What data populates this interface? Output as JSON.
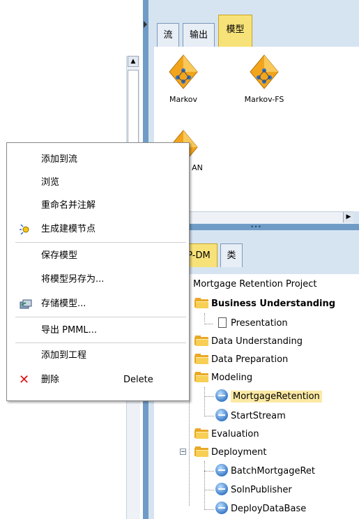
{
  "palette_tabs": [
    "流",
    "输出",
    "模型"
  ],
  "models": [
    {
      "label": "Markov",
      "icon": "model-nugget-icon"
    },
    {
      "label": "Markov-FS",
      "icon": "model-nugget-icon"
    },
    {
      "label": "AN",
      "icon": "model-nugget-icon"
    }
  ],
  "manager_tabs": [
    "P-DM",
    "类"
  ],
  "context_menu": {
    "items": [
      {
        "label": "添加到流"
      },
      {
        "label": "浏览"
      },
      {
        "label": "重命名并注解"
      },
      {
        "label": "生成建模节点",
        "icon": "sparkle-icon"
      },
      {
        "label": "保存模型"
      },
      {
        "label": "将模型另存为..."
      },
      {
        "label": "存储模型...",
        "icon": "store-icon"
      },
      {
        "label": "导出 PMML..."
      },
      {
        "label": "添加到工程"
      },
      {
        "label": "删除",
        "icon": "delete-x-icon",
        "shortcut": "Delete"
      }
    ]
  },
  "project_tree": {
    "root": "Mortgage Retention Project",
    "nodes": [
      {
        "label": "Business Understanding",
        "type": "folder"
      },
      {
        "label": "Presentation",
        "type": "document"
      },
      {
        "label": "Data Understanding",
        "type": "folder"
      },
      {
        "label": "Data Preparation",
        "type": "folder"
      },
      {
        "label": "Modeling",
        "type": "folder"
      },
      {
        "label": "MortgageRetention",
        "type": "stream"
      },
      {
        "label": "StartStream",
        "type": "stream"
      },
      {
        "label": "Evaluation",
        "type": "folder"
      },
      {
        "label": "Deployment",
        "type": "folder"
      },
      {
        "label": "BatchMortgageRet",
        "type": "stream"
      },
      {
        "label": "SolnPublisher",
        "type": "stream"
      },
      {
        "label": "DeployDataBase",
        "type": "stream"
      }
    ]
  },
  "colors": {
    "frame": "#6f9cc6",
    "panel": "#d6e4f2",
    "active_tab": "#f7e27a",
    "selection": "#fbe9a3",
    "delete": "#e01010"
  }
}
